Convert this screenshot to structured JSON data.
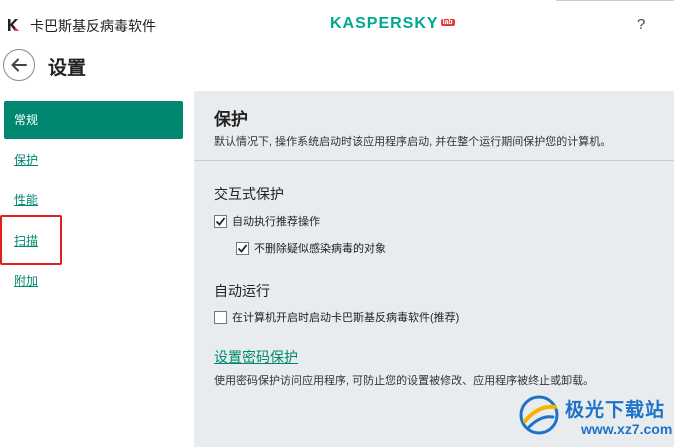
{
  "window": {
    "app_title": "卡巴斯基反病毒软件",
    "logo_text": "KASPERSKY",
    "logo_badge": "lab",
    "help_label": "?"
  },
  "header": {
    "page_title": "设置"
  },
  "sidebar": {
    "items": [
      {
        "label": "常规",
        "active": true
      },
      {
        "label": "保护",
        "active": false
      },
      {
        "label": "性能",
        "active": false
      },
      {
        "label": "扫描",
        "active": false,
        "highlighted": true
      },
      {
        "label": "附加",
        "active": false
      }
    ]
  },
  "content": {
    "title": "保护",
    "description": "默认情况下, 操作系统启动时该应用程序启动, 并在整个运行期间保护您的计算机。",
    "interactive": {
      "title": "交互式保护",
      "auto_action": {
        "label": "自动执行推荐操作",
        "checked": true
      },
      "no_delete": {
        "label": "不删除疑似感染病毒的对象",
        "checked": true
      }
    },
    "autorun": {
      "title": "自动运行",
      "startup": {
        "label": "在计算机开启时启动卡巴斯基反病毒软件(推荐)",
        "checked": false
      }
    },
    "password": {
      "link": "设置密码保护",
      "description": "使用密码保护访问应用程序, 可防止您的设置被修改、应用程序被终止或卸载。"
    }
  },
  "watermark": {
    "name": "极光下载站",
    "url": "www.xz7.com"
  },
  "colors": {
    "accent": "#00876f",
    "logo": "#00a88e",
    "content_bg": "#e9ecee",
    "highlight": "#e02020",
    "watermark": "#1e73c8"
  }
}
